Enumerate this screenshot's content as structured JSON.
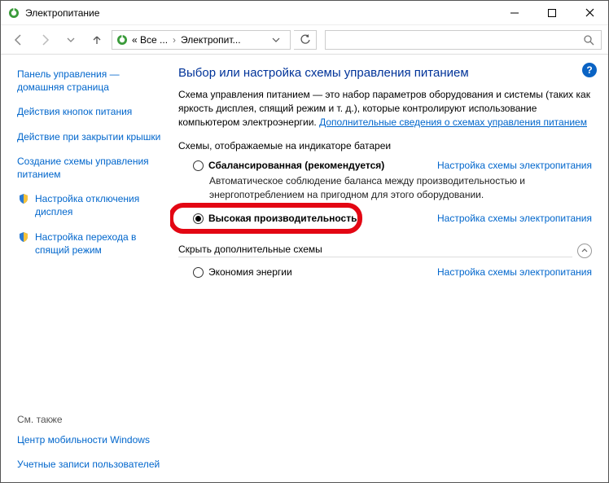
{
  "window": {
    "title": "Электропитание"
  },
  "addressbar": {
    "crumb1": "« Все ...",
    "crumb2": "Электропит..."
  },
  "sidebar": {
    "home": "Панель управления — домашняя страница",
    "link1": "Действия кнопок питания",
    "link2": "Действие при закрытии крышки",
    "link3": "Создание схемы управления питанием",
    "link4": "Настройка отключения дисплея",
    "link5": "Настройка перехода в спящий режим",
    "seealso": "См. также",
    "bottom1": "Центр мобильности Windows",
    "bottom2": "Учетные записи пользователей"
  },
  "main": {
    "heading": "Выбор или настройка схемы управления питанием",
    "description_pre": "Схема управления питанием — это набор параметров оборудования и системы (таких как яркость дисплея, спящий режим и т. д.), которые контролируют использование компьютером электроэнергии. ",
    "description_link": "Дополнительные сведения о схемах управления питанием",
    "section1": "Схемы, отображаемые на индикаторе батареи",
    "plan1": {
      "label": "Сбалансированная (рекомендуется)",
      "link": "Настройка схемы электропитания",
      "desc": "Автоматическое соблюдение баланса между производительностью и энергопотреблением на пригодном для этого оборудовании."
    },
    "plan2": {
      "label": "Высокая производительность",
      "link": "Настройка схемы электропитания"
    },
    "section2": "Скрыть дополнительные схемы",
    "plan3": {
      "label": "Экономия энергии",
      "link": "Настройка схемы электропитания"
    }
  }
}
